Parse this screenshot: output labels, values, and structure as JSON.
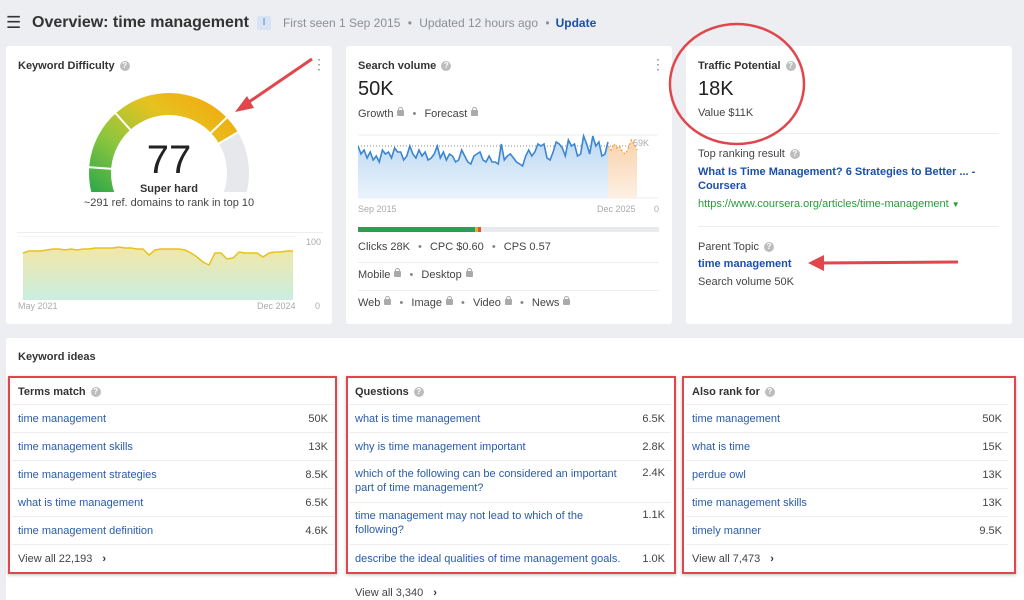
{
  "header": {
    "title": "Overview: time management",
    "badge": "I",
    "first_seen": "First seen 1 Sep 2015",
    "updated": "Updated 12 hours ago",
    "separator": "•",
    "update_label": "Update"
  },
  "keyword_difficulty": {
    "title": "Keyword Difficulty",
    "value": "77",
    "score": 77,
    "score_max": 100,
    "label": "Super hard",
    "subtext": "~291 ref. domains to rank in top 10",
    "chart": {
      "x_start": "May 2021",
      "x_end": "Dec 2024",
      "y_max": "100",
      "y_min": "0"
    }
  },
  "search_volume": {
    "title": "Search volume",
    "value": "50K",
    "growth_label": "Growth",
    "forecast_label": "Forecast",
    "chart": {
      "x_start": "Sep 2015",
      "x_end": "Dec 2025",
      "ref_label": "59K",
      "y_min": "0"
    },
    "clicks_split": {
      "organic_fraction": 0.39,
      "paid_fraction": 0.01
    },
    "clicks_row": "Clicks 28K",
    "cpc_row": "CPC $0.60",
    "cps_row": "CPS 0.57",
    "devices": [
      "Mobile",
      "Desktop"
    ],
    "serp_types": [
      "Web",
      "Image",
      "Video",
      "News"
    ]
  },
  "traffic_potential": {
    "title": "Traffic Potential",
    "value": "18K",
    "value_text": "Value $11K",
    "top_result_label": "Top ranking result",
    "top_result_title": "What Is Time Management? 6 Strategies to Better ... - Coursera",
    "top_result_url": "https://www.coursera.org/articles/time-management",
    "parent_topic_label": "Parent Topic",
    "parent_topic": "time management",
    "parent_topic_volume": "Search volume 50K"
  },
  "keyword_ideas": {
    "title": "Keyword ideas",
    "columns": [
      {
        "title": "Terms match",
        "rows": [
          {
            "keyword": "time management",
            "volume": "50K"
          },
          {
            "keyword": "time management skills",
            "volume": "13K"
          },
          {
            "keyword": "time management strategies",
            "volume": "8.5K"
          },
          {
            "keyword": "what is time management",
            "volume": "6.5K"
          },
          {
            "keyword": "time management definition",
            "volume": "4.6K"
          }
        ],
        "view_all": "View all 22,193"
      },
      {
        "title": "Questions",
        "rows": [
          {
            "keyword": "what is time management",
            "volume": "6.5K"
          },
          {
            "keyword": "why is time management important",
            "volume": "2.8K"
          },
          {
            "keyword": "which of the following can be considered an important part of time management?",
            "volume": "2.4K"
          },
          {
            "keyword": "time management may not lead to which of the following?",
            "volume": "1.1K"
          },
          {
            "keyword": "describe the ideal qualities of time management goals.",
            "volume": "1.0K"
          }
        ],
        "view_all": "View all 3,340"
      },
      {
        "title": "Also rank for",
        "rows": [
          {
            "keyword": "time management",
            "volume": "50K"
          },
          {
            "keyword": "what is time",
            "volume": "15K"
          },
          {
            "keyword": "perdue owl",
            "volume": "13K"
          },
          {
            "keyword": "time management skills",
            "volume": "13K"
          },
          {
            "keyword": "timely manner",
            "volume": "9.5K"
          }
        ],
        "view_all": "View all 7,473"
      }
    ]
  },
  "colors": {
    "link": "#2a5ba8",
    "link_bold": "#1b4fa8",
    "url_green": "#2a9a3c",
    "annotation_red": "#e0464c",
    "series_blue": "#3a86d0",
    "forecast_orange": "#f0a64a",
    "kd_line": "#e6c21f"
  }
}
